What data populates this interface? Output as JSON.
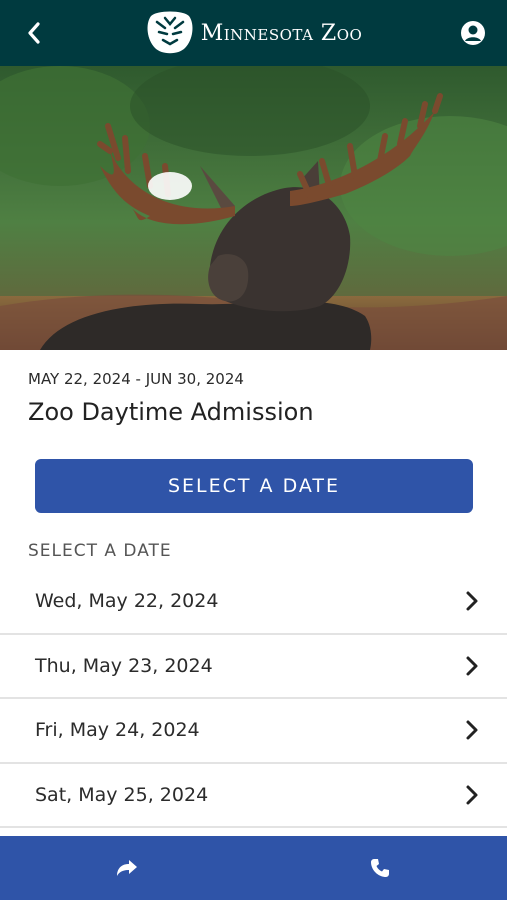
{
  "header": {
    "logo_text": "Minnesota Zoo",
    "icons": {
      "back": "chevron-left-icon",
      "account": "user-circle-icon"
    }
  },
  "event": {
    "date_range": "MAY 22, 2024 - JUN 30, 2024",
    "title": "Zoo Daytime Admission"
  },
  "actions": {
    "select_date_button": "SELECT A DATE"
  },
  "dates_section": {
    "label": "SELECT A DATE",
    "items": [
      {
        "label": "Wed, May 22, 2024"
      },
      {
        "label": "Thu, May 23, 2024"
      },
      {
        "label": "Fri, May 24, 2024"
      },
      {
        "label": "Sat, May 25, 2024"
      }
    ]
  },
  "bottom_bar": {
    "icons": {
      "share": "share-icon",
      "call": "phone-icon"
    }
  },
  "colors": {
    "header_bg": "#003a3f",
    "accent": "#2f54a8"
  }
}
